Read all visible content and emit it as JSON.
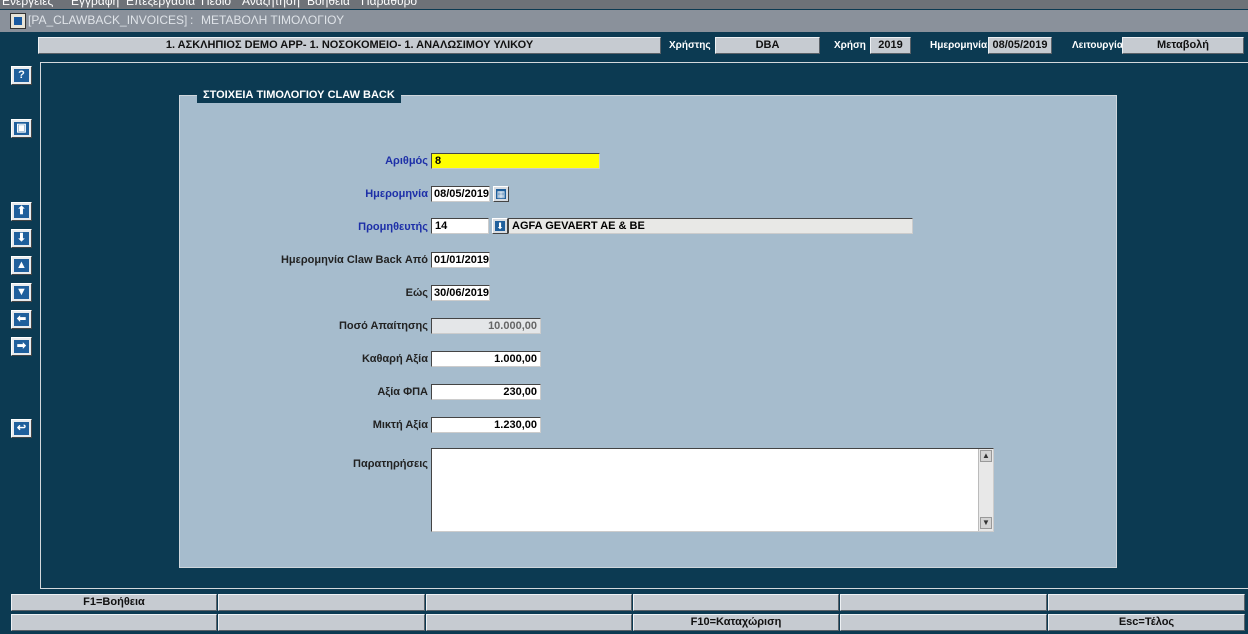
{
  "menu": [
    "Ενέργειες",
    "Εγγραφή",
    "Επεξεργασία",
    "Πεδίο",
    "Αναζήτηση",
    "Βοήθεια",
    "Παράθυρο"
  ],
  "window": {
    "title": "[PA_CLAWBACK_INVOICES]",
    "subtitle": "ΜΕΤΑΒΟΛΗ ΤΙΜΟΛΟΓΙΟΥ"
  },
  "header": {
    "context": "1. ΑΣΚΛΗΠΙΟΣ DEMO APP- 1. ΝΟΣΟΚΟΜΕΙΟ- 1. ΑΝΑΛΩΣΙΜΟΥ ΥΛΙΚΟΥ",
    "user_label": "Χρήστης",
    "user_value": "DBA",
    "year_label": "Χρήση",
    "year_value": "2019",
    "date_label": "Ημερομηνία",
    "date_value": "08/05/2019",
    "mode_label": "Λειτουργία",
    "mode_value": "Μεταβολή"
  },
  "sidebar": [
    "help-icon",
    "save-icon",
    "first-record-icon",
    "last-record-icon",
    "previous-record-icon",
    "next-record-icon",
    "previous-block-icon",
    "next-block-icon",
    "exit-icon"
  ],
  "form": {
    "title": "ΣΤΟΙΧΕΙΑ ΤΙΜΟΛΟΓΙΟΥ CLAW BACK",
    "number_label": "Αριθμός",
    "number_value": "8",
    "date_label": "Ημερομηνία",
    "date_value": "08/05/2019",
    "supplier_label": "Προμηθευτής",
    "supplier_code": "14",
    "supplier_name": "AGFA GEVAERT AE & BE",
    "from_label": "Ημερομηνία Claw Back Από",
    "from_value": "01/01/2019",
    "to_label": "Εώς",
    "to_value": "30/06/2019",
    "claim_label": "Ποσό Απαίτησης",
    "claim_value": "10.000,00",
    "net_label": "Καθαρή Αξία",
    "net_value": "1.000,00",
    "vat_label": "Αξία ΦΠΑ",
    "vat_value": "230,00",
    "gross_label": "Μικτή Αξία",
    "gross_value": "1.230,00",
    "remarks_label": "Παρατηρήσεις",
    "remarks_value": ""
  },
  "fkeys": {
    "row1": [
      "F1=Βοήθεια",
      "",
      "",
      "",
      "",
      ""
    ],
    "row2": [
      "",
      "",
      "",
      "F10=Καταχώριση",
      "",
      "Esc=Τέλος"
    ]
  },
  "colors": {
    "background": "#0c3a52",
    "panel": "#a6bccd",
    "required_label": "#1d2fa8",
    "highlight": "#ffff00"
  }
}
